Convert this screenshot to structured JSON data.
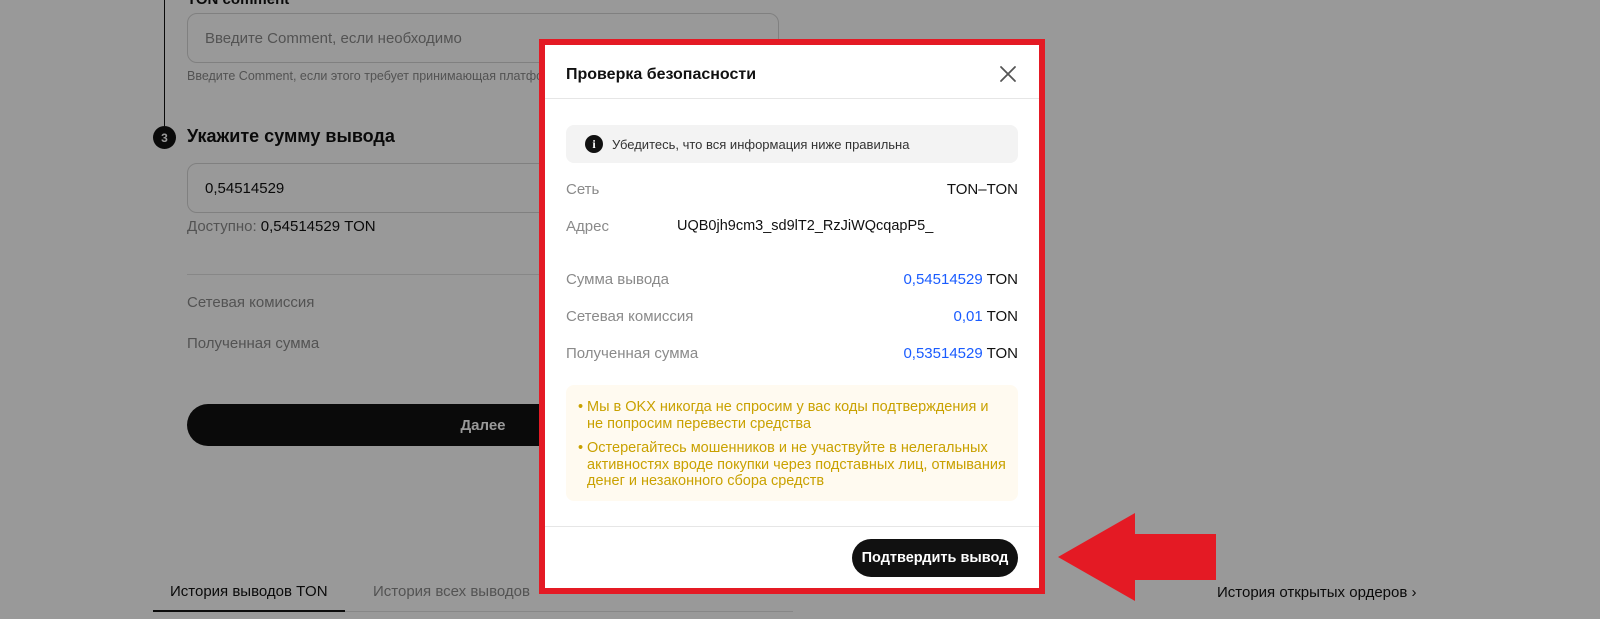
{
  "background": {
    "comment_label": "TON comment",
    "comment_placeholder": "Введите Comment, если необходимо",
    "comment_hint": "Введите Comment, если этого требует принимающая платформа",
    "step_number": "3",
    "step_title": "Укажите сумму вывода",
    "amount_value": "0,54514529",
    "available_label": "Доступно: ",
    "available_value": "0,54514529 TON",
    "fee_label": "Сетевая комиссия",
    "received_label": "Полученная сумма",
    "next_button": "Далее",
    "tabs": [
      {
        "label": "История выводов TON",
        "active": true
      },
      {
        "label": "История всех выводов",
        "active": false
      }
    ],
    "open_orders_link": "История открытых ордеров",
    "open_orders_chevron": "›"
  },
  "modal": {
    "title": "Проверка безопасности",
    "info_icon_glyph": "i",
    "info_text": "Убедитесь, что вся информация ниже правильна",
    "network_label": "Сеть",
    "network_value": "TON–TON",
    "address_label": "Адрес",
    "address_value": "UQB0jh9cm3_sd9lT2_RzJiWQcqapP5_",
    "withdraw_label": "Сумма вывода",
    "withdraw_amount": "0,54514529",
    "withdraw_currency": " TON",
    "fee_label": "Сетевая комиссия",
    "fee_amount": "0,01",
    "fee_currency": " TON",
    "received_label": "Полученная сумма",
    "received_amount": "0,53514529",
    "received_currency": " TON",
    "warnings": [
      "Мы в OKX никогда не спросим у вас коды подтверждения и не попросим перевести средства",
      "Остерегайтесь мошенников и не участвуйте в нелегальных активностях вроде покупки через подставных лиц, отмывания денег и незаконного сбора средств"
    ],
    "confirm_button": "Подтвердить вывод"
  },
  "colors": {
    "highlight_frame": "#e41a24",
    "accent_blue": "#1a5cff",
    "warning_text": "#c9a100"
  }
}
